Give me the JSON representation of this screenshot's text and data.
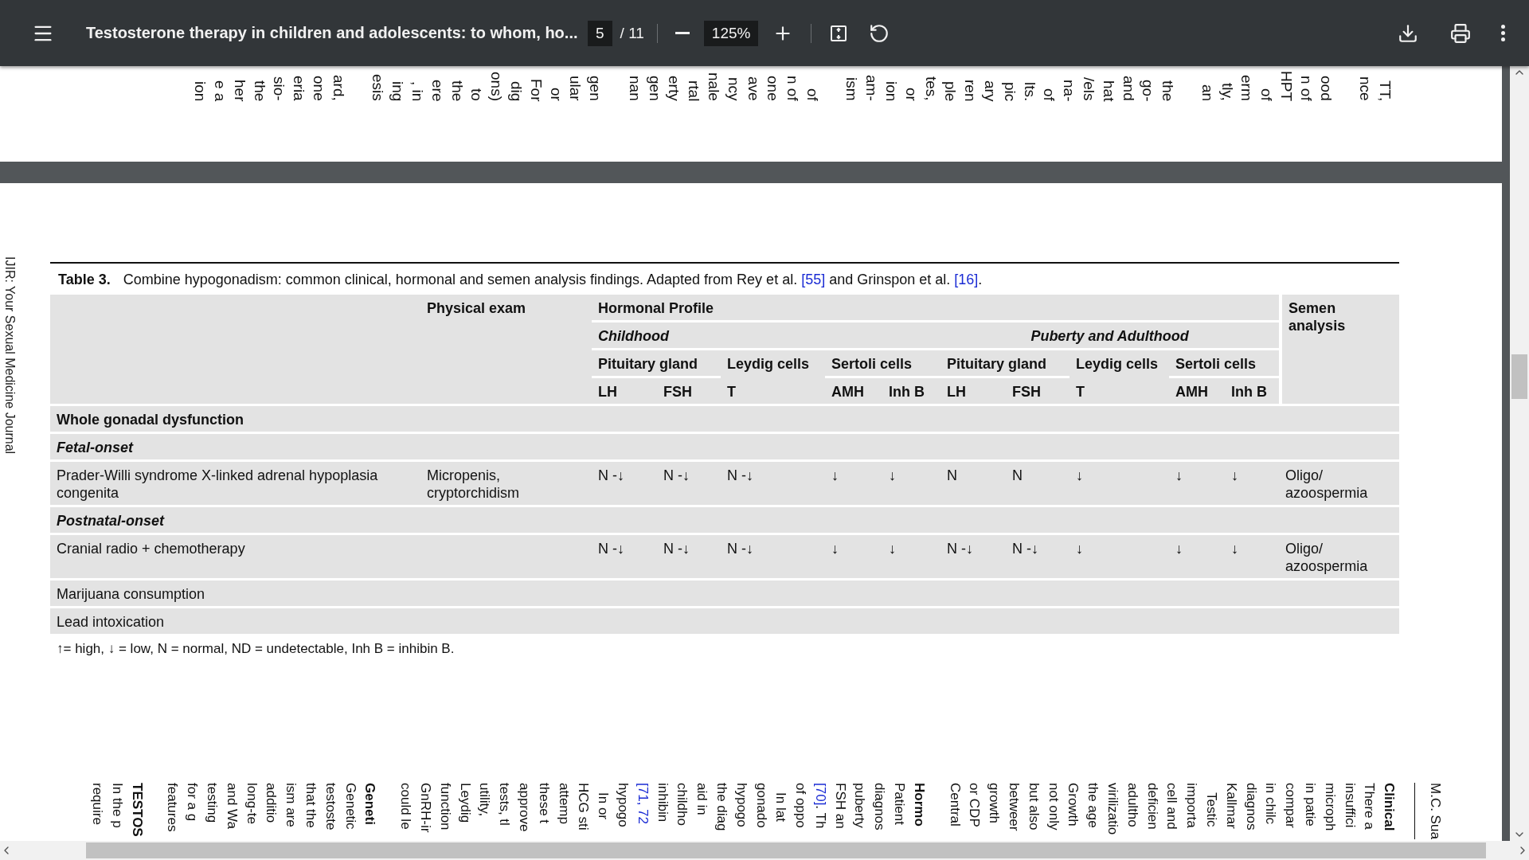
{
  "toolbar": {
    "title": "Testosterone therapy in children and adolescents: to whom, ho...",
    "page": "5",
    "page_total": "/ 11",
    "zoom": "125%"
  },
  "prev_page_lines": [
    [
      "TT,",
      "nce"
    ],
    [
      "ood",
      "n of",
      "HPT",
      "of",
      "erm",
      "tly,",
      "an"
    ],
    [
      "the",
      "go-",
      "and",
      "hat",
      "/els",
      "na-",
      "of",
      "lts.",
      "pic",
      "ary",
      "ren",
      "ple",
      "tes,",
      "or",
      "ion",
      "am-",
      "ism"
    ],
    [
      "of",
      "n of",
      "one",
      "ave",
      "ncy",
      "nale",
      "rtal",
      "erty",
      "gen",
      "nan"
    ],
    [
      "gen",
      "ular",
      "or",
      "For",
      "dig",
      "ons)",
      "to",
      "the",
      "ere",
      ", in",
      "ing",
      "esis"
    ],
    [
      "ard,",
      "one",
      "eria",
      "sio-",
      "the",
      "her",
      "e a",
      "ion"
    ]
  ],
  "running_head": "IJIR: Your Sexual Medicine Journal",
  "table": {
    "label": "Table 3.",
    "caption": [
      {
        "kind": "text",
        "text": "Combine hypogonadism: common clinical, hormonal and semen analysis findings. Adapted from Rey et al. "
      },
      {
        "kind": "link",
        "text": "[55]"
      },
      {
        "kind": "text",
        "text": " and Grinspon et al. "
      },
      {
        "kind": "link",
        "text": "[16]"
      },
      {
        "kind": "text",
        "text": "."
      }
    ],
    "physical_heading": "Physical exam",
    "hormonal_heading": "Hormonal Profile",
    "semen_heading": "Semen analysis",
    "periods": [
      {
        "label": "Childhood",
        "groups": [
          {
            "label": "Pituitary gland",
            "markers": [
              "LH",
              "FSH"
            ]
          },
          {
            "label": "Leydig cells",
            "markers": [
              "T"
            ]
          },
          {
            "label": "Sertoli cells",
            "markers": [
              "AMH",
              "Inh B"
            ]
          }
        ]
      },
      {
        "label": "Puberty and Adulthood",
        "groups": [
          {
            "label": "Pituitary gland",
            "markers": [
              "LH",
              "FSH"
            ]
          },
          {
            "label": "Leydig cells",
            "markers": [
              "T"
            ]
          },
          {
            "label": "Sertoli cells",
            "markers": [
              "AMH",
              "Inh B"
            ]
          }
        ]
      }
    ],
    "rows": [
      {
        "kind": "section",
        "label": "Whole gonadal dysfunction"
      },
      {
        "kind": "subsection",
        "label": "Fetal-onset"
      },
      {
        "kind": "entry",
        "label": "Prader-Willi syndrome X-linked adrenal hypoplasia congenita",
        "physical": "Micropenis, cryptorchidism",
        "values": [
          "N -↓",
          "N -↓",
          "N -↓",
          "↓",
          "↓",
          "N",
          "N",
          "↓",
          "↓",
          "↓"
        ],
        "semen": "Oligo/ azoospermia"
      },
      {
        "kind": "subsection",
        "label": "Postnatal-onset"
      },
      {
        "kind": "entry",
        "label": "Cranial radio + chemotherapy",
        "values": [
          "N -↓",
          "N -↓",
          "N -↓",
          "↓",
          "↓",
          "N -↓",
          "N -↓",
          "↓",
          "↓",
          "↓"
        ],
        "semen": "Oligo/ azoospermia"
      },
      {
        "kind": "entry",
        "label": "Marijuana consumption"
      },
      {
        "kind": "entry",
        "label": "Lead intoxication"
      }
    ],
    "footnote": "↑= high, ↓ = low, N = normal, ND = undetectable, Inh B = inhibin B."
  },
  "next_lines": [
    {
      "kind": "header",
      "text": "M.C. Sua"
    },
    {
      "kind": "heading",
      "text": "Clinical"
    },
    {
      "kind": "line",
      "text": "There a"
    },
    {
      "kind": "line",
      "text": "insuffici"
    },
    {
      "kind": "line",
      "text": "microph"
    },
    {
      "kind": "line",
      "text": "in patie"
    },
    {
      "kind": "line",
      "text": "compar"
    },
    {
      "kind": "line",
      "text": "in chilc"
    },
    {
      "kind": "line",
      "text": "diagnos"
    },
    {
      "kind": "line",
      "text": "Kallmar"
    },
    {
      "kind": "indent",
      "text": "Testic"
    },
    {
      "kind": "line",
      "text": "importa"
    },
    {
      "kind": "line",
      "text": "cell and"
    },
    {
      "kind": "line",
      "text": "deficien"
    },
    {
      "kind": "line",
      "text": "adultho"
    },
    {
      "kind": "line",
      "text": "virilizatio"
    },
    {
      "kind": "line",
      "text": "the age"
    },
    {
      "kind": "line",
      "text": "Growth"
    },
    {
      "kind": "line",
      "text": "not only"
    },
    {
      "kind": "line",
      "text": "but also"
    },
    {
      "kind": "line",
      "text": "betweer"
    },
    {
      "kind": "line",
      "text": "growth"
    },
    {
      "kind": "line",
      "text": "or CDP"
    },
    {
      "kind": "line",
      "text": "Central"
    },
    {
      "kind": "heading",
      "text": "Hormo"
    },
    {
      "kind": "line",
      "text": "Patient"
    },
    {
      "kind": "line",
      "text": "diagnos"
    },
    {
      "kind": "line",
      "text": "puberty"
    },
    {
      "kind": "line",
      "text": "FSH an"
    },
    {
      "kind": "line",
      "link": "[70]",
      "text": ". Th"
    },
    {
      "kind": "line",
      "text": "of oppo"
    },
    {
      "kind": "indent",
      "text": "In lat"
    },
    {
      "kind": "line",
      "text": "gonado"
    },
    {
      "kind": "line",
      "text": "hypogo"
    },
    {
      "kind": "line",
      "text": "the diag"
    },
    {
      "kind": "line",
      "text": "aid in"
    },
    {
      "kind": "line",
      "text": "childho"
    },
    {
      "kind": "line",
      "text": "inhibin"
    },
    {
      "kind": "line",
      "link": "[71, 72"
    },
    {
      "kind": "line",
      "text": "hypogo"
    },
    {
      "kind": "indent",
      "text": "In or"
    },
    {
      "kind": "line",
      "text": "HCG sti"
    },
    {
      "kind": "line",
      "text": "attemp"
    },
    {
      "kind": "line",
      "text": "these t"
    },
    {
      "kind": "line",
      "text": "approve"
    },
    {
      "kind": "line",
      "text": "tests, tl"
    },
    {
      "kind": "line",
      "text": "utility,"
    },
    {
      "kind": "line",
      "text": "Leydig"
    },
    {
      "kind": "line",
      "text": "function"
    },
    {
      "kind": "line",
      "text": "GnRH-ir"
    },
    {
      "kind": "line",
      "text": "could le"
    },
    {
      "kind": "heading",
      "text": "Geneti"
    },
    {
      "kind": "line",
      "text": "Genetic"
    },
    {
      "kind": "line",
      "text": "testoste"
    },
    {
      "kind": "line",
      "text": "that the"
    },
    {
      "kind": "line",
      "text": "ism are"
    },
    {
      "kind": "line",
      "text": "additio"
    },
    {
      "kind": "line",
      "text": "long-te"
    },
    {
      "kind": "line",
      "text": "and Wa"
    },
    {
      "kind": "line",
      "text": "testing"
    },
    {
      "kind": "line",
      "text": "for a g"
    },
    {
      "kind": "line",
      "text": "features"
    },
    {
      "kind": "heading",
      "text": "TESTOS"
    },
    {
      "kind": "line",
      "text": "In the p"
    },
    {
      "kind": "line",
      "text": "require"
    }
  ]
}
